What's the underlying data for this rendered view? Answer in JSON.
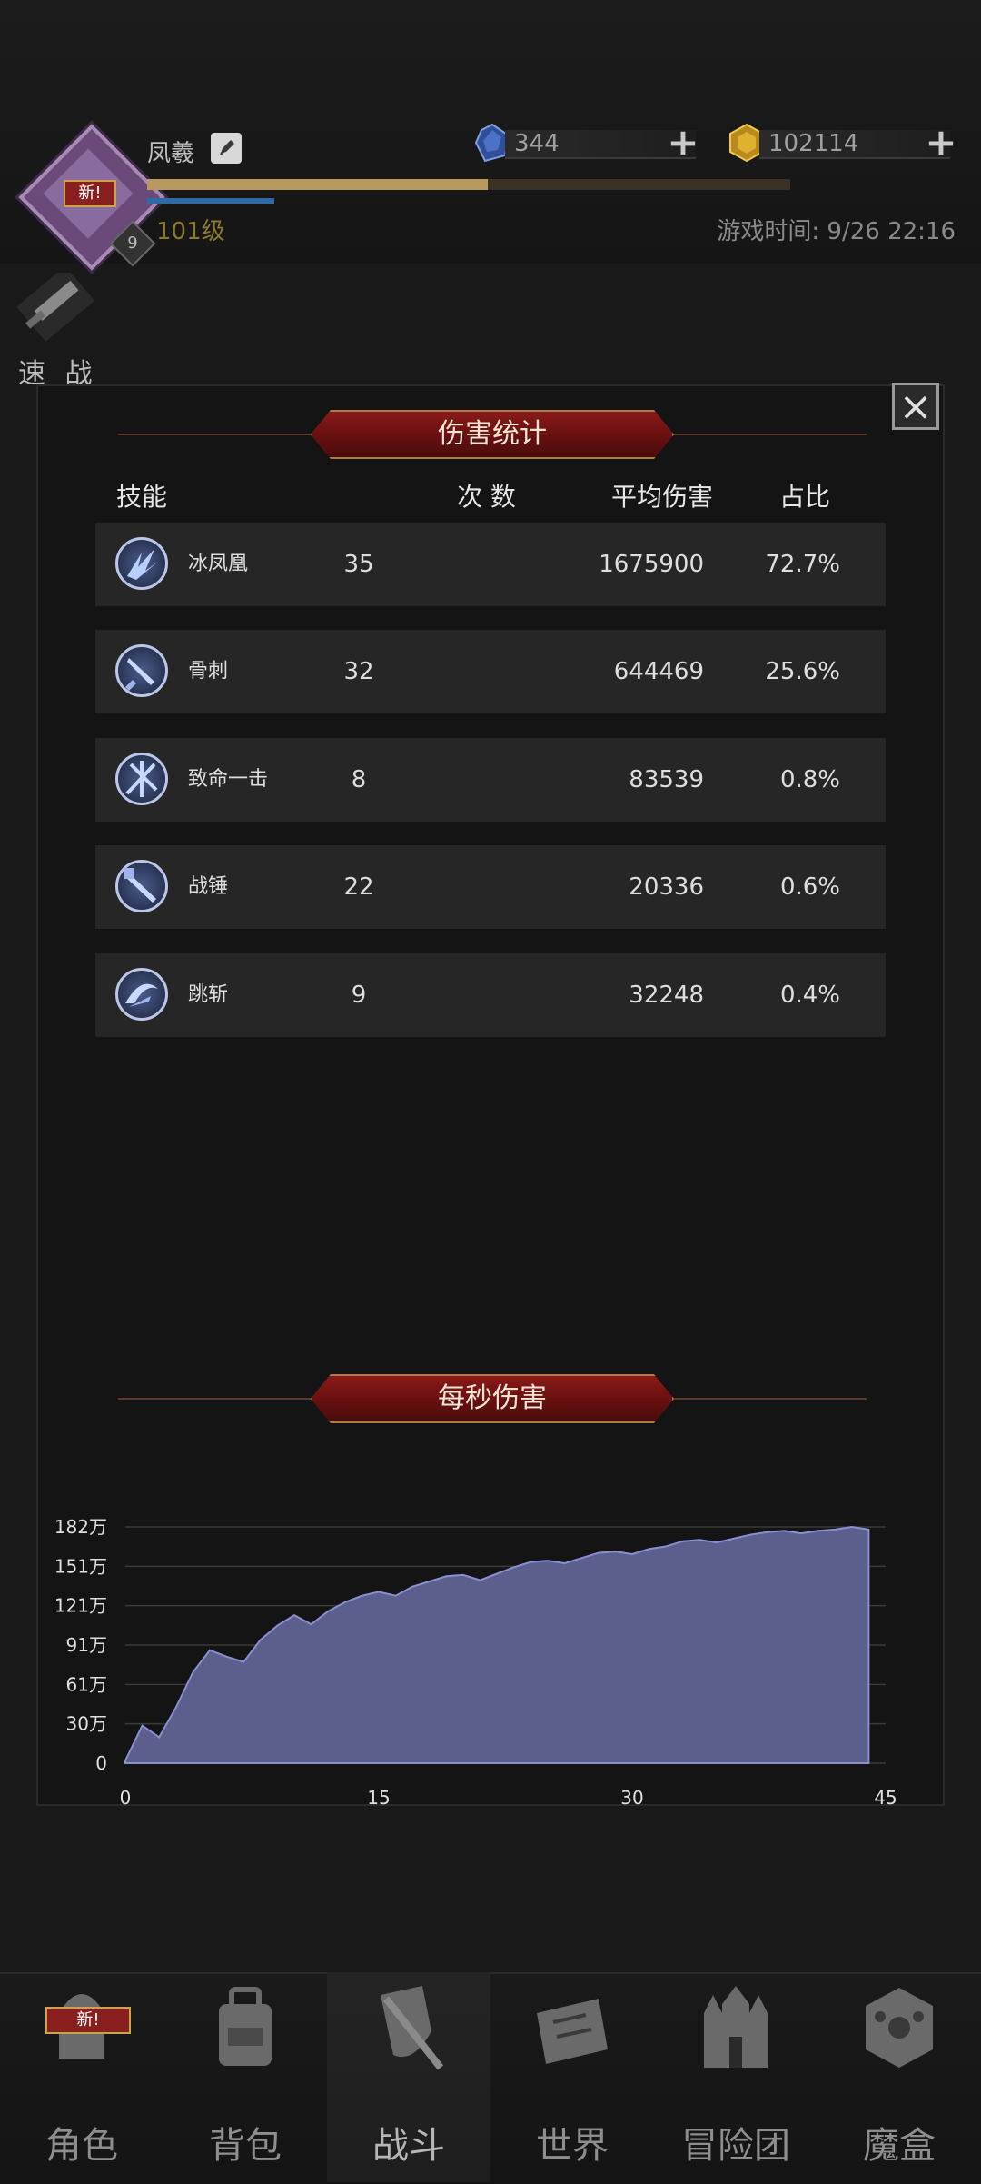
{
  "player": {
    "name": "凤羲",
    "level_text": "101级",
    "avatar_badge": "新!",
    "avatar_level": "9",
    "xp_progress": 0.53,
    "game_time": "游戏时间: 9/26 22:16"
  },
  "currencies": [
    {
      "icon": "blue-crystal-icon",
      "value": "344"
    },
    {
      "icon": "gold-crystal-icon",
      "value": "102114"
    }
  ],
  "quick_battle": {
    "label": "速 战"
  },
  "dialog": {
    "close_icon": "close-icon",
    "damage_stats": {
      "title": "伤害统计",
      "headers": {
        "skill": "技能",
        "count": "次 数",
        "avg": "平均伤害",
        "pct": "占比"
      },
      "rows": [
        {
          "icon": "ice-phoenix-icon",
          "name": "冰凤凰",
          "count": "35",
          "avg": "1675900",
          "pct": "72.7%"
        },
        {
          "icon": "bone-spike-icon",
          "name": "骨刺",
          "count": "32",
          "avg": "644469",
          "pct": "25.6%"
        },
        {
          "icon": "critical-strike-icon",
          "name": "致命一击",
          "count": "8",
          "avg": "83539",
          "pct": "0.8%"
        },
        {
          "icon": "war-hammer-icon",
          "name": "战锤",
          "count": "22",
          "avg": "20336",
          "pct": "0.6%"
        },
        {
          "icon": "leap-slash-icon",
          "name": "跳斩",
          "count": "9",
          "avg": "32248",
          "pct": "0.4%"
        }
      ]
    },
    "dps": {
      "title": "每秒伤害"
    }
  },
  "chart_data": {
    "type": "area",
    "title": "每秒伤害",
    "xlabel": "",
    "ylabel": "",
    "xlim": [
      0,
      45
    ],
    "ylim": [
      0,
      1820000
    ],
    "x_ticks": [
      "0",
      "15",
      "30",
      "45"
    ],
    "y_ticks": [
      "0",
      "30万",
      "61万",
      "91万",
      "121万",
      "151万",
      "182万"
    ],
    "grid": true,
    "x": [
      0,
      1,
      2,
      3,
      4,
      5,
      6,
      7,
      8,
      9,
      10,
      11,
      12,
      13,
      14,
      15,
      16,
      17,
      18,
      19,
      20,
      21,
      22,
      23,
      24,
      25,
      26,
      27,
      28,
      29,
      30,
      31,
      32,
      33,
      34,
      35,
      36,
      37,
      38,
      39,
      40,
      41,
      42,
      43,
      44
    ],
    "values": [
      20000,
      290000,
      200000,
      430000,
      700000,
      870000,
      820000,
      780000,
      950000,
      1060000,
      1140000,
      1070000,
      1170000,
      1240000,
      1290000,
      1320000,
      1290000,
      1360000,
      1400000,
      1440000,
      1450000,
      1410000,
      1460000,
      1510000,
      1550000,
      1560000,
      1540000,
      1580000,
      1620000,
      1630000,
      1610000,
      1650000,
      1670000,
      1710000,
      1720000,
      1700000,
      1730000,
      1760000,
      1780000,
      1790000,
      1770000,
      1790000,
      1800000,
      1820000,
      1800000
    ],
    "fill_color": "#5c5f8e",
    "line_color": "#8a8fd0"
  },
  "nav": {
    "items": [
      {
        "label": "角色",
        "icon": "helmet-icon",
        "badge": "新!"
      },
      {
        "label": "背包",
        "icon": "backpack-icon"
      },
      {
        "label": "战斗",
        "icon": "shield-sword-icon"
      },
      {
        "label": "世界",
        "icon": "map-scroll-icon"
      },
      {
        "label": "冒险团",
        "icon": "castle-icon"
      },
      {
        "label": "魔盒",
        "icon": "magic-box-icon"
      }
    ]
  }
}
